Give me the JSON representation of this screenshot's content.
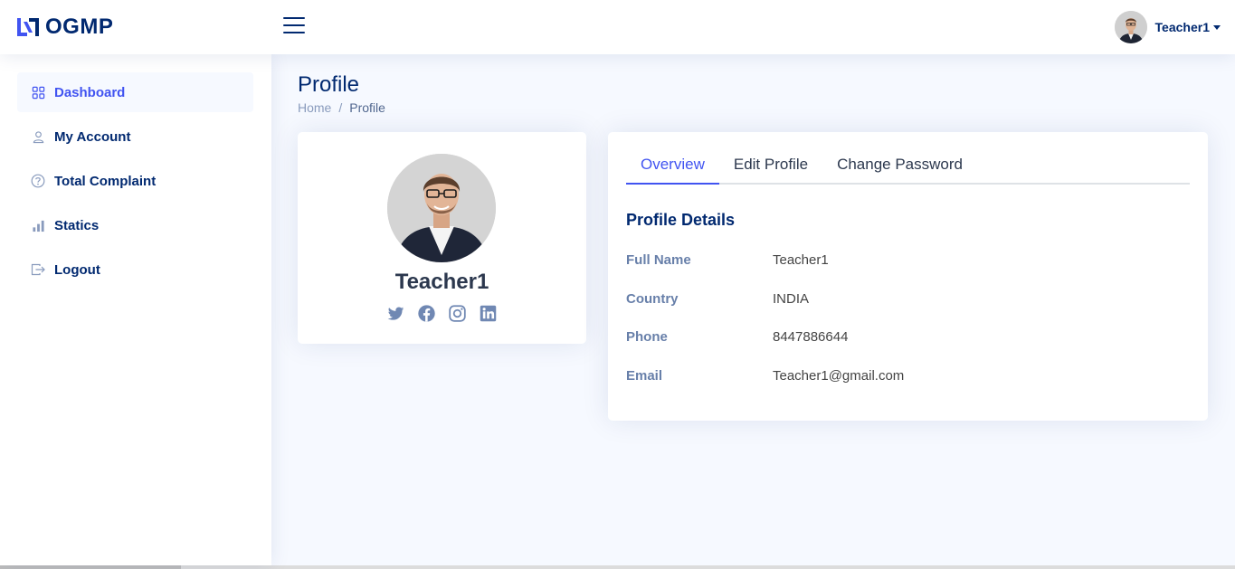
{
  "header": {
    "brand": "OGMP",
    "user_name": "Teacher1"
  },
  "sidebar": {
    "items": [
      {
        "label": "Dashboard",
        "icon": "grid-icon",
        "active": true
      },
      {
        "label": "My Account",
        "icon": "person-icon"
      },
      {
        "label": "Total Complaint",
        "icon": "question-circle-icon"
      },
      {
        "label": "Statics",
        "icon": "bar-chart-icon"
      },
      {
        "label": "Logout",
        "icon": "box-arrow-right-icon"
      }
    ]
  },
  "page": {
    "title": "Profile",
    "breadcrumb": [
      "Home",
      "/",
      "Profile"
    ]
  },
  "profile_card": {
    "name": "Teacher1",
    "socials": [
      "twitter-icon",
      "facebook-icon",
      "instagram-icon",
      "linkedin-icon"
    ]
  },
  "tabs": [
    {
      "label": "Overview",
      "active": true
    },
    {
      "label": "Edit Profile"
    },
    {
      "label": "Change Password"
    }
  ],
  "details": {
    "title": "Profile Details",
    "rows": [
      {
        "label": "Full Name",
        "value": "Teacher1"
      },
      {
        "label": "Country",
        "value": "INDIA"
      },
      {
        "label": "Phone",
        "value": "8447886644"
      },
      {
        "label": "Email",
        "value": "Teacher1@gmail.com"
      }
    ]
  },
  "colors": {
    "brand": "#012970",
    "accent": "#4154f1",
    "background": "#f6f9ff",
    "label": "#899bbd"
  }
}
